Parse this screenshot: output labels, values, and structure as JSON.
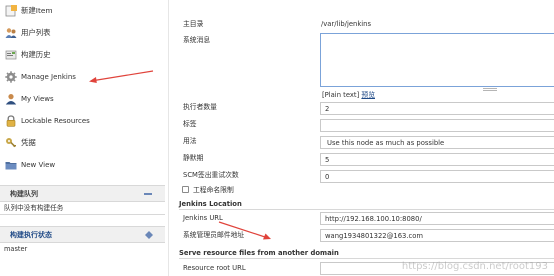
{
  "sidebar": {
    "tasks": [
      {
        "label": "新建Item",
        "icon": "new-item-icon"
      },
      {
        "label": "用户列表",
        "icon": "users-icon"
      },
      {
        "label": "构建历史",
        "icon": "build-history-icon"
      },
      {
        "label": "Manage Jenkins",
        "icon": "gear-icon"
      },
      {
        "label": "My Views",
        "icon": "user-views-icon"
      },
      {
        "label": "Lockable Resources",
        "icon": "lock-icon"
      },
      {
        "label": "凭据",
        "icon": "credentials-icon"
      },
      {
        "label": "New View",
        "icon": "folder-icon"
      }
    ],
    "build_queue": {
      "title": "构建队列",
      "empty_text": "队列中没有构建任务"
    },
    "executor_status": {
      "title": "构建执行状态",
      "node": "master"
    }
  },
  "config": {
    "home_dir_label": "主目录",
    "home_dir_value": "/var/lib/jenkins",
    "system_message_label": "系统消息",
    "plain_text_label": "[Plain text]",
    "preview_label": "预览",
    "executors_label": "执行者数量",
    "executors_value": "2",
    "labels_label": "标签",
    "labels_value": "",
    "usage_label": "用法",
    "usage_value": "Use this node as much as possible",
    "quiet_period_label": "静默期",
    "quiet_period_value": "5",
    "scm_retry_label": "SCM签出重试次数",
    "scm_retry_value": "0",
    "restrict_names_label": "工程命名限制",
    "jenkins_location_title": "Jenkins Location",
    "jenkins_url_label": "Jenkins URL",
    "jenkins_url_value": "http://192.168.100.10:8080/",
    "admin_email_label": "系统管理员邮件地址",
    "admin_email_value": "wang1934801322@163.com",
    "resource_section_title": "Serve resource files from another domain",
    "resource_root_label": "Resource root URL",
    "resource_root_value": ""
  },
  "watermark": "https://blog.csdn.net/root193",
  "colors": {
    "annotation_arrow": "#e0433b",
    "link": "#204a87",
    "focus_border": "#7ba3d9"
  }
}
